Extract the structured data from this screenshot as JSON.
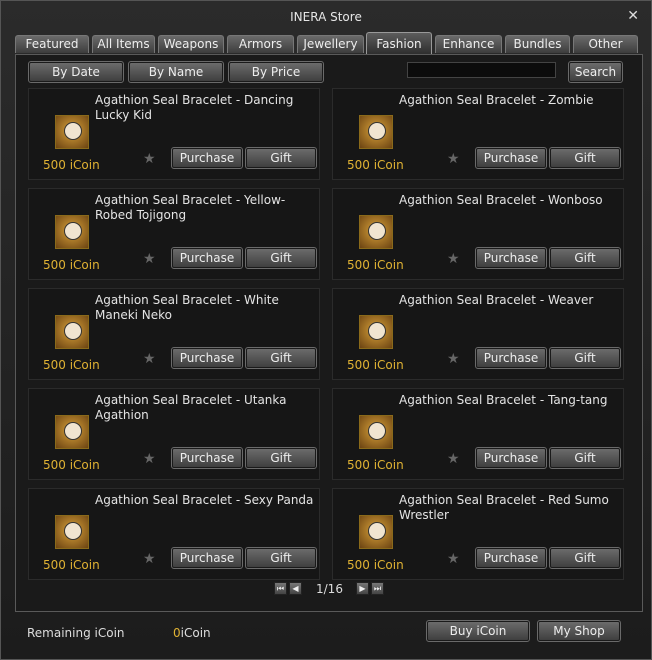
{
  "window": {
    "title": "INERA Store",
    "close_icon": "close-icon"
  },
  "tabs": [
    {
      "label": "Featured",
      "active": false
    },
    {
      "label": "All Items",
      "active": false
    },
    {
      "label": "Weapons",
      "active": false
    },
    {
      "label": "Armors",
      "active": false
    },
    {
      "label": "Jewellery",
      "active": false
    },
    {
      "label": "Fashion",
      "active": true
    },
    {
      "label": "Enhance",
      "active": false
    },
    {
      "label": "Bundles",
      "active": false
    },
    {
      "label": "Other",
      "active": false
    }
  ],
  "sort": {
    "by_date": "By Date",
    "by_name": "By Name",
    "by_price": "By Price"
  },
  "search": {
    "value": "",
    "button": "Search"
  },
  "items": [
    {
      "name": "Agathion Seal Bracelet - Dancing Lucky Kid",
      "price": "500 iCoin",
      "purchase": "Purchase",
      "gift": "Gift",
      "icon": "agathion-icon"
    },
    {
      "name": "Agathion Seal Bracelet - Zombie",
      "price": "500 iCoin",
      "purchase": "Purchase",
      "gift": "Gift",
      "icon": "agathion-icon"
    },
    {
      "name": "Agathion Seal Bracelet - Yellow-Robed Tojigong",
      "price": "500 iCoin",
      "purchase": "Purchase",
      "gift": "Gift",
      "icon": "agathion-icon"
    },
    {
      "name": "Agathion Seal Bracelet - Wonboso",
      "price": "500 iCoin",
      "purchase": "Purchase",
      "gift": "Gift",
      "icon": "agathion-icon"
    },
    {
      "name": "Agathion Seal Bracelet - White Maneki Neko",
      "price": "500 iCoin",
      "purchase": "Purchase",
      "gift": "Gift",
      "icon": "agathion-icon"
    },
    {
      "name": "Agathion Seal Bracelet - Weaver",
      "price": "500 iCoin",
      "purchase": "Purchase",
      "gift": "Gift",
      "icon": "agathion-icon"
    },
    {
      "name": "Agathion Seal Bracelet - Utanka Agathion",
      "price": "500 iCoin",
      "purchase": "Purchase",
      "gift": "Gift",
      "icon": "agathion-icon"
    },
    {
      "name": "Agathion Seal Bracelet - Tang-tang",
      "price": "500 iCoin",
      "purchase": "Purchase",
      "gift": "Gift",
      "icon": "agathion-icon"
    },
    {
      "name": "Agathion Seal Bracelet - Sexy Panda",
      "price": "500 iCoin",
      "purchase": "Purchase",
      "gift": "Gift",
      "icon": "agathion-icon"
    },
    {
      "name": "Agathion Seal Bracelet - Red Sumo Wrestler",
      "price": "500 iCoin",
      "purchase": "Purchase",
      "gift": "Gift",
      "icon": "agathion-icon"
    }
  ],
  "pagination": {
    "text": "1/16",
    "first": "first-page-icon",
    "prev": "prev-page-icon",
    "next": "next-page-icon",
    "last": "last-page-icon"
  },
  "footer": {
    "remaining_label": "Remaining iCoin",
    "balance": "0",
    "balance_unit": "iCoin",
    "buy_icoin": "Buy iCoin",
    "my_shop": "My Shop"
  },
  "colors": {
    "price": "#e0b233",
    "accent_border": "#8a6a1a"
  }
}
